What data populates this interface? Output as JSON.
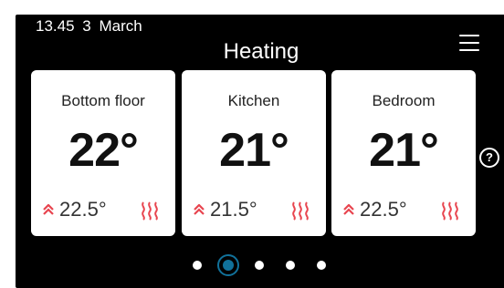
{
  "status": {
    "time": "13.45",
    "day": "3",
    "month": "March"
  },
  "header": {
    "title": "Heating",
    "menu_icon": "hamburger-menu-icon"
  },
  "rooms": [
    {
      "name": "Bottom floor",
      "temperature": "22°",
      "setpoint": "22.5°"
    },
    {
      "name": "Kitchen",
      "temperature": "21°",
      "setpoint": "21.5°"
    },
    {
      "name": "Bedroom",
      "temperature": "21°",
      "setpoint": "22.5°"
    }
  ],
  "help": {
    "label": "?"
  },
  "pagination": {
    "pages": 5,
    "active_index": 1
  },
  "colors": {
    "accent": "#11719a",
    "heat": "#e8454f",
    "background": "#000000",
    "card": "#ffffff"
  }
}
